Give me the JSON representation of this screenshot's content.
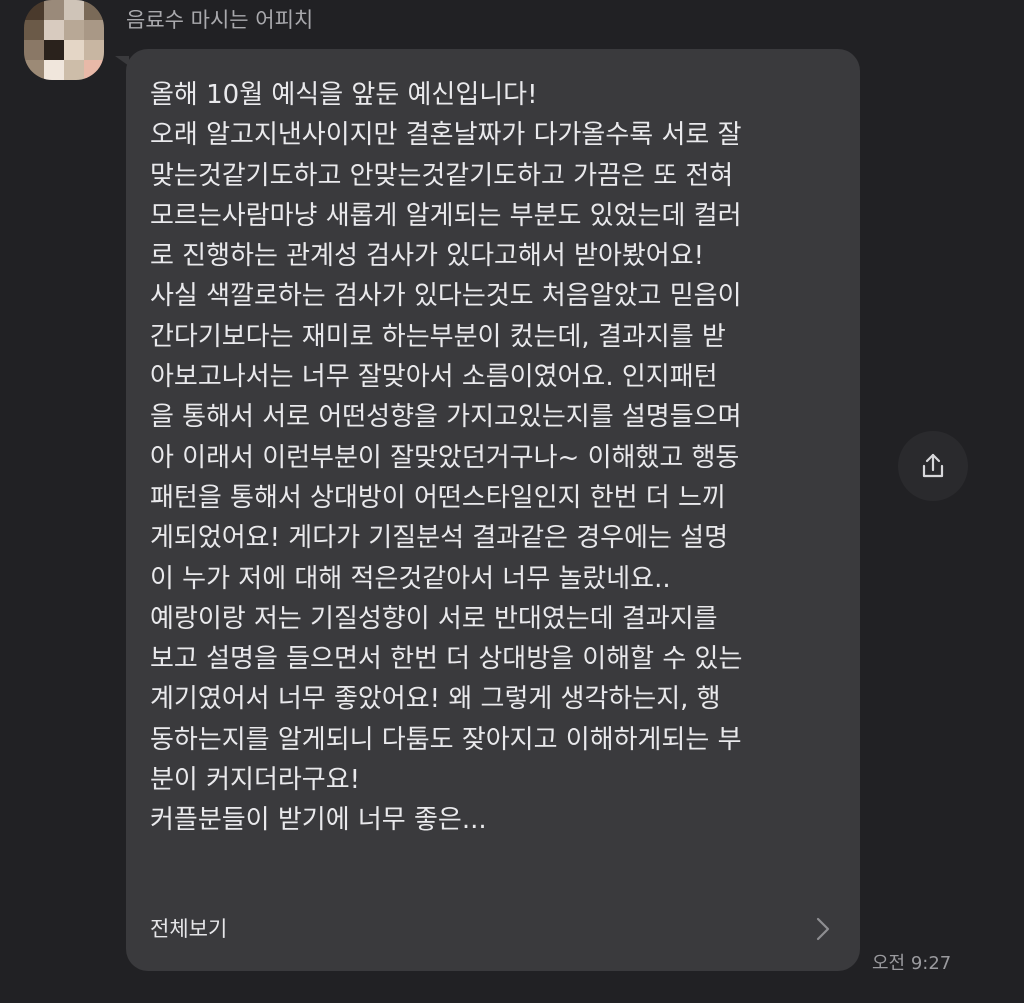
{
  "chat": {
    "sender_name": "음료수 마시는 어피치",
    "avatar_icon": "blurred-profile-avatar",
    "message": {
      "lines": [
        "올해 10월 예식을 앞둔 예신입니다!",
        "오래 알고지낸사이지만 결혼날짜가 다가올수록 서로 잘",
        "맞는것같기도하고 안맞는것같기도하고 가끔은 또 전혀",
        "모르는사람마냥 새롭게 알게되는 부분도 있었는데 컬러",
        "로 진행하는 관계성 검사가 있다고해서 받아봤어요!",
        "사실 색깔로하는 검사가 있다는것도 처음알았고 믿음이",
        "간다기보다는 재미로 하는부분이 컸는데, 결과지를 받",
        "아보고나서는 너무 잘맞아서 소름이였어요. 인지패턴",
        "을 통해서 서로 어떤성향을 가지고있는지를 설명들으며",
        "아 이래서 이런부분이 잘맞았던거구나~ 이해했고 행동",
        "패턴을 통해서 상대방이 어떤스타일인지 한번 더 느끼",
        "게되었어요! 게다가 기질분석 결과같은 경우에는 설명",
        "이 누가 저에 대해 적은것같아서 너무 놀랐네요..",
        "예랑이랑 저는 기질성향이 서로 반대였는데 결과지를",
        "보고 설명을 들으면서 한번 더 상대방을 이해할 수 있는",
        "계기였어서 너무 좋았어요! 왜 그렇게 생각하는지, 행",
        "동하는지를 알게되니 다툼도 잦아지고 이해하게되는 부",
        "분이 커지더라구요!",
        "커플분들이 받기에 너무 좋은..."
      ],
      "view_all_label": "전체보기",
      "view_all_icon": "chevron-right-icon",
      "timestamp": "오전 9:27"
    },
    "share_icon": "share-icon",
    "colors": {
      "background": "#212124",
      "bubble": "#3a3a3d",
      "text": "#e9e9ec",
      "secondary_text": "#a9a9ad"
    }
  }
}
